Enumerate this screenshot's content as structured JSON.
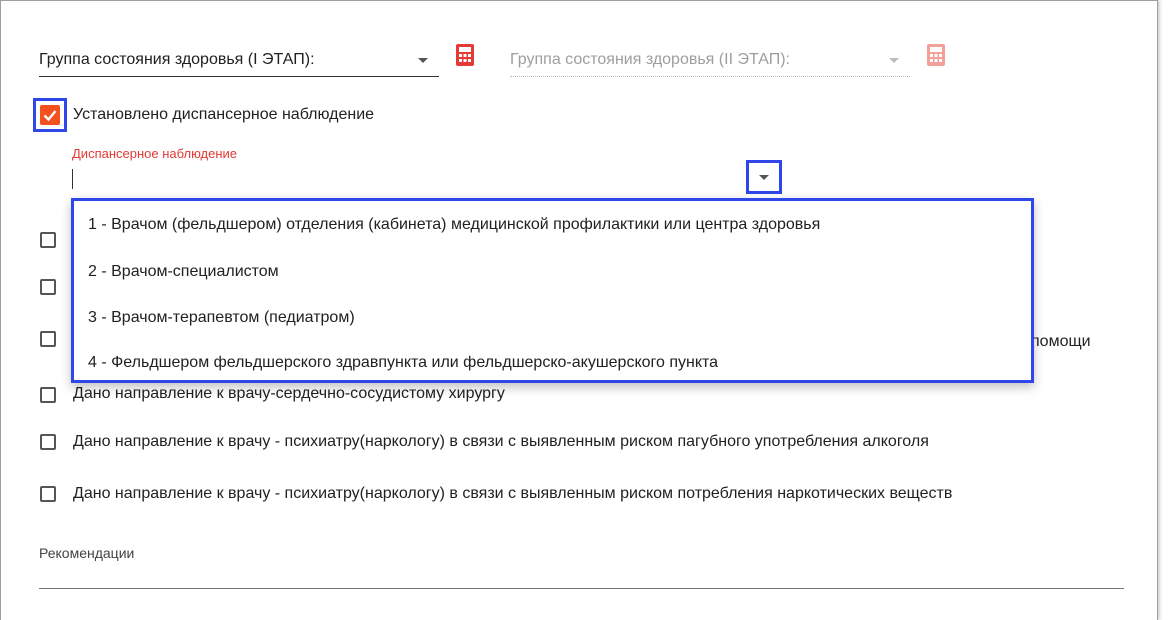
{
  "health_group": {
    "stage1_label": "Группа состояния здоровья (I ЭТАП):",
    "stage2_label": "Группа состояния здоровья (II ЭТАП):"
  },
  "dispensary": {
    "checkbox_label": "Установлено диспансерное наблюдение",
    "checked": true,
    "field_label": "Диспансерное наблюдение",
    "field_value": ""
  },
  "dropdown_options": [
    "1 - Врачом (фельдшером) отделения (кабинета) медицинской профилактики или центра здоровья",
    "2 - Врачом-специалистом",
    "3 - Врачом-терапевтом (педиатром)",
    "4 - Фельдшером фельдшерского здравпункта или фельдшерско-акушерского пункта"
  ],
  "checkboxes": [
    {
      "label": "",
      "checked": false
    },
    {
      "label": "",
      "checked": false
    },
    {
      "label": "помощи",
      "checked": false
    },
    {
      "label": "Дано направление к врачу-сердечно-сосудистому хирургу",
      "checked": false
    },
    {
      "label": "Дано направление к врачу - психиатру(наркологу) в связи с выявленным риском пагубного употребления алкоголя",
      "checked": false
    },
    {
      "label": "Дано направление к врачу - психиатру(наркологу) в связи с выявленным риском потребления наркотических веществ",
      "checked": false
    }
  ],
  "recommendations": {
    "label": "Рекомендации",
    "value": ""
  },
  "colors": {
    "accent": "#f4511e",
    "focus": "#2f46e8",
    "error_label": "#e53935"
  },
  "icons": {
    "calculator_active": "calculator-icon",
    "calculator_disabled": "calculator-icon",
    "caret": "caret-down-icon",
    "check": "check-icon"
  }
}
